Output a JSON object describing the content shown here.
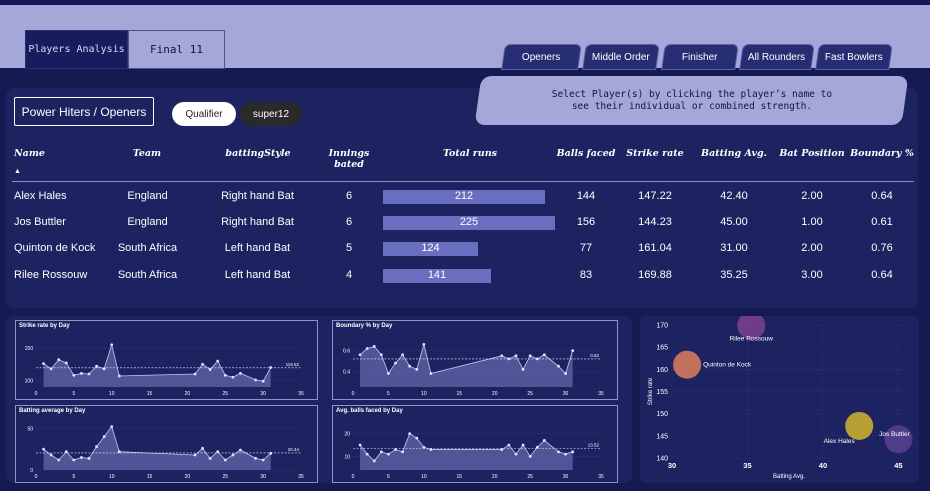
{
  "tabs": [
    {
      "label": "Players Analysis",
      "active": true
    },
    {
      "label": "Final 11",
      "active": false
    }
  ],
  "nav_buttons": [
    "Openers",
    "Middle Order",
    "Finisher",
    "All Rounders",
    "Fast Bowlers"
  ],
  "page_heading": "Power Hiters / Openers",
  "filters": {
    "qualifier": "Qualifier",
    "super12": "super12"
  },
  "tooltip_text": "Select Player(s) by clicking the player’s name to see their individual or combined strength.",
  "table": {
    "headers": [
      "Name",
      "Team",
      "battingStyle",
      "Innings bated",
      "Total runs",
      "Balls faced",
      "Strike rate",
      "Batting Avg.",
      "Bat Position",
      "Boundary %"
    ],
    "rows": [
      {
        "name": "Alex Hales",
        "team": "England",
        "style": "Right hand Bat",
        "innings": "6",
        "runs": "212",
        "runs_value": 212,
        "balls": "144",
        "sr": "147.22",
        "avg": "42.40",
        "pos": "2.00",
        "boundary": "0.64"
      },
      {
        "name": "Jos Buttler",
        "team": "England",
        "style": "Right hand Bat",
        "innings": "6",
        "runs": "225",
        "runs_value": 225,
        "balls": "156",
        "sr": "144.23",
        "avg": "45.00",
        "pos": "1.00",
        "boundary": "0.61"
      },
      {
        "name": "Quinton de Kock",
        "team": "South Africa",
        "style": "Left hand Bat",
        "innings": "5",
        "runs": "124",
        "runs_value": 124,
        "balls": "77",
        "sr": "161.04",
        "avg": "31.00",
        "pos": "2.00",
        "boundary": "0.76"
      },
      {
        "name": "Rilee Rossouw",
        "team": "South Africa",
        "style": "Left hand Bat",
        "innings": "4",
        "runs": "141",
        "runs_value": 141,
        "balls": "83",
        "sr": "169.88",
        "avg": "35.25",
        "pos": "3.00",
        "boundary": "0.64"
      }
    ]
  },
  "chart_data": [
    {
      "type": "area",
      "title": "Strike rate by Day",
      "x": [
        1,
        2,
        3,
        4,
        5,
        6,
        7,
        8,
        9,
        10,
        11,
        21,
        22,
        23,
        24,
        25,
        26,
        27,
        29,
        30,
        31
      ],
      "y": [
        126,
        118,
        132,
        127,
        108,
        111,
        110,
        122,
        118,
        155,
        107,
        110,
        125,
        117,
        130,
        108,
        105,
        111,
        101,
        99,
        120
      ],
      "ylim": [
        90,
        170
      ],
      "xlim": [
        0,
        35
      ],
      "ytick_labels": [
        "100",
        "150"
      ],
      "ytick_values": [
        100,
        150
      ],
      "xtick_labels": [
        "0",
        "5",
        "10",
        "15",
        "20",
        "25",
        "30",
        "35"
      ],
      "reference_value": 119.52,
      "reference_label": "119.52"
    },
    {
      "type": "area",
      "title": "Boundary % by Day",
      "x": [
        1,
        2,
        3,
        4,
        5,
        6,
        7,
        8,
        9,
        10,
        11,
        21,
        22,
        23,
        24,
        25,
        26,
        27,
        29,
        30,
        31
      ],
      "y": [
        0.56,
        0.62,
        0.64,
        0.56,
        0.38,
        0.48,
        0.56,
        0.45,
        0.42,
        0.66,
        0.38,
        0.55,
        0.52,
        0.55,
        0.42,
        0.55,
        0.52,
        0.56,
        0.45,
        0.38,
        0.6
      ],
      "ylim": [
        0.25,
        0.75
      ],
      "xlim": [
        0,
        35
      ],
      "ytick_labels": [
        "0.4",
        "0.6"
      ],
      "ytick_values": [
        0.4,
        0.6
      ],
      "xtick_labels": [
        "0",
        "5",
        "10",
        "15",
        "20",
        "25",
        "30",
        "35"
      ],
      "reference_value": 0.52,
      "reference_label": "0.52"
    },
    {
      "type": "area",
      "title": "Batting average by Day",
      "x": [
        1,
        2,
        3,
        4,
        5,
        6,
        7,
        8,
        9,
        10,
        11,
        21,
        22,
        23,
        24,
        25,
        26,
        27,
        29,
        30,
        31
      ],
      "y": [
        25,
        18,
        12,
        22,
        12,
        15,
        14,
        28,
        40,
        52,
        22,
        18,
        26,
        14,
        22,
        12,
        18,
        24,
        14,
        12,
        20
      ],
      "ylim": [
        0,
        60
      ],
      "xlim": [
        0,
        35
      ],
      "ytick_labels": [
        "0",
        "50"
      ],
      "ytick_values": [
        0,
        50
      ],
      "xtick_labels": [
        "0",
        "5",
        "10",
        "15",
        "20",
        "25",
        "30",
        "35"
      ],
      "reference_value": 20.44,
      "reference_label": "20.44"
    },
    {
      "type": "area",
      "title": "Avg. balls faced by Day",
      "x": [
        1,
        2,
        3,
        4,
        5,
        6,
        7,
        8,
        9,
        10,
        11,
        21,
        22,
        23,
        24,
        25,
        26,
        27,
        29,
        30,
        31
      ],
      "y": [
        15,
        11,
        8,
        12,
        11,
        13,
        12,
        20,
        18,
        14,
        13,
        13,
        15,
        11,
        15,
        10,
        14,
        17,
        12,
        11,
        12
      ],
      "ylim": [
        4,
        26
      ],
      "xlim": [
        0,
        35
      ],
      "ytick_labels": [
        "10",
        "20"
      ],
      "ytick_values": [
        10,
        20
      ],
      "xtick_labels": [
        "0",
        "5",
        "10",
        "15",
        "20",
        "25",
        "30",
        "35"
      ],
      "reference_value": 13.52,
      "reference_label": "13.52"
    },
    {
      "type": "scatter",
      "xlabel": "Batting Avg.",
      "ylabel": "Strike rate",
      "xlim": [
        30,
        45.5
      ],
      "ylim": [
        140,
        170
      ],
      "xtick_labels": [
        "30",
        "35",
        "40",
        "45"
      ],
      "xtick_values": [
        30,
        35,
        40,
        45
      ],
      "ytick_labels": [
        "140",
        "145",
        "150",
        "155",
        "160",
        "165",
        "170"
      ],
      "ytick_values": [
        140,
        145,
        150,
        155,
        160,
        165,
        170
      ],
      "points": [
        {
          "label": "Rilee Rossouw",
          "x": 35.25,
          "y": 169.88,
          "color": "#7a3f8c"
        },
        {
          "label": "Quinton de Kock",
          "x": 31.0,
          "y": 161.04,
          "color": "#d4795c"
        },
        {
          "label": "Jos Buttler",
          "x": 45.0,
          "y": 144.23,
          "color": "#55408e"
        },
        {
          "label": "Alex Hales",
          "x": 42.4,
          "y": 147.22,
          "color": "#c9ae2f"
        }
      ]
    }
  ]
}
